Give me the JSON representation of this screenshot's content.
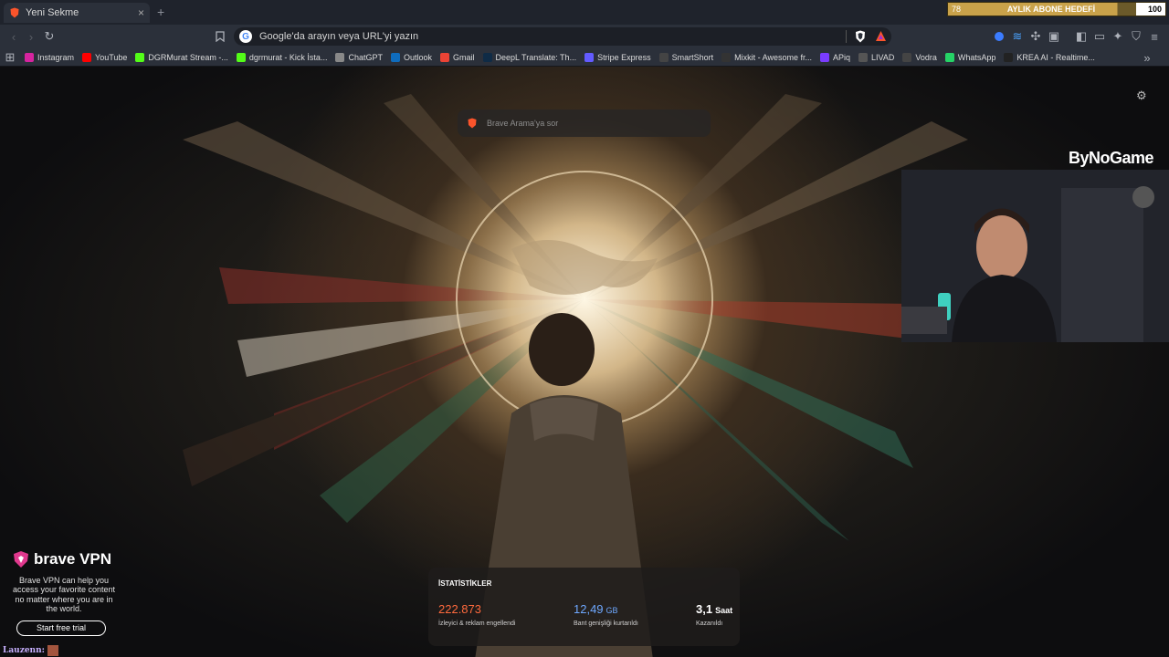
{
  "tab": {
    "title": "Yeni Sekme",
    "close": "×",
    "new_tab": "+"
  },
  "overlay_goal": {
    "current": "78",
    "label": "AYLIK ABONE HEDEFİ",
    "target": "100",
    "progress": 0.78
  },
  "toolbar": {
    "url_placeholder": "Google'da arayın veya URL'yi yazın"
  },
  "bookmarks": [
    {
      "label": "Instagram",
      "color": "#d6249f"
    },
    {
      "label": "YouTube",
      "color": "#ff0000"
    },
    {
      "label": "DGRMurat Stream -...",
      "color": "#53fc18"
    },
    {
      "label": "dgrmurat - Kick İsta...",
      "color": "#53fc18"
    },
    {
      "label": "ChatGPT",
      "color": "#888888"
    },
    {
      "label": "Outlook",
      "color": "#0f6cbd"
    },
    {
      "label": "Gmail",
      "color": "#ea4335"
    },
    {
      "label": "DeepL Translate: Th...",
      "color": "#0f2b46"
    },
    {
      "label": "Stripe Express",
      "color": "#635bff"
    },
    {
      "label": "SmartShort",
      "color": "#444444"
    },
    {
      "label": "Mixkit - Awesome fr...",
      "color": "#333333"
    },
    {
      "label": "APiq",
      "color": "#7a3cff"
    },
    {
      "label": "LIVAD",
      "color": "#555555"
    },
    {
      "label": "Vodra",
      "color": "#444444"
    },
    {
      "label": "WhatsApp",
      "color": "#25d366"
    },
    {
      "label": "KREA AI - Realtime...",
      "color": "#222222"
    }
  ],
  "search": {
    "placeholder": "Brave Arama'ya sor"
  },
  "webcam": {
    "brand": "ByNoGame"
  },
  "vpn": {
    "title": "brave VPN",
    "text": "Brave VPN can help you access your favorite content no matter where you are in the world.",
    "button": "Start free trial"
  },
  "stats": {
    "title": "İSTATİSTİKLER",
    "items": [
      {
        "value": "222.873",
        "unit": "",
        "label": "İzleyici & reklam engellendi",
        "color": "#ff6a3d"
      },
      {
        "value": "12,49",
        "unit": "GB",
        "label": "Bant genişliği kurtarıldı",
        "color": "#6ea8ff"
      },
      {
        "value": "3,1",
        "unit": "Saat",
        "label": "Kazanıldı",
        "color": "#ffffff"
      }
    ]
  },
  "chat": {
    "user": "Lauzenn:"
  }
}
